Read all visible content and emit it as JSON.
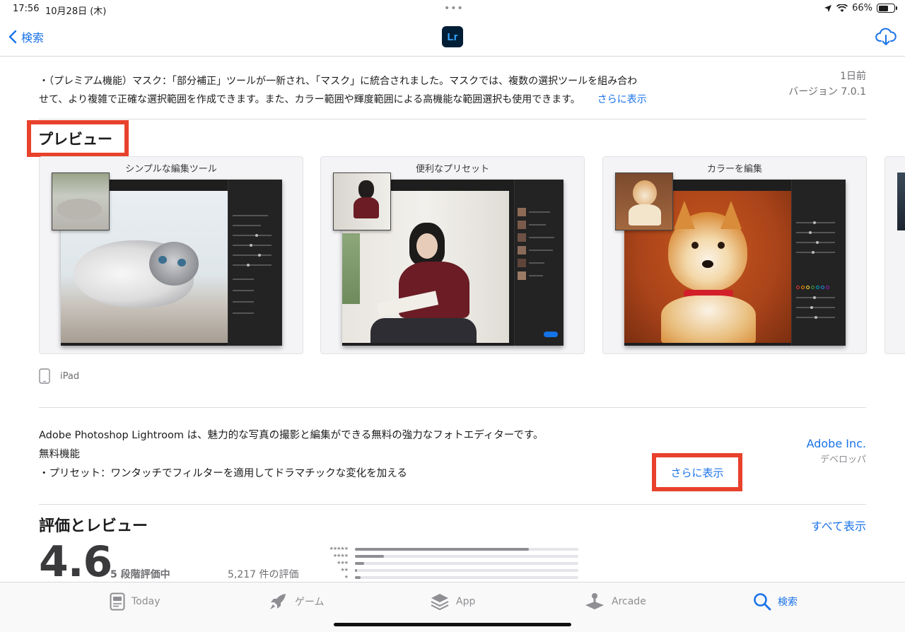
{
  "status": {
    "time": "17:56",
    "date": "10月28日 (木)",
    "battery": "66%",
    "battery_level": 0.66
  },
  "nav": {
    "back_label": "検索",
    "app_icon_label": "Lr"
  },
  "whats_new": {
    "line1": "・（プレミアム機能）マスク：「部分補正」ツールが一新され、「マスク」に統合されました。マスクでは、複数の選択ツールを組み合わ",
    "line2": "せて、より複雑で正確な選択範囲を作成できます。また、カラー範囲や輝度範囲による高機能な範囲選択も使用できます。",
    "more": "さらに表示",
    "date": "1日前",
    "version": "バージョン 7.0.1"
  },
  "preview": {
    "title": "プレビュー",
    "screenshots": [
      {
        "caption": "シンプルな編集ツール"
      },
      {
        "caption": "便利なプリセット"
      },
      {
        "caption": "カラーを編集"
      }
    ],
    "device_label": "iPad"
  },
  "description": {
    "line1": "Adobe Photoshop Lightroom は、魅力的な写真の撮影と編集ができる無料の強力なフォトエディターです。",
    "line2": "無料機能",
    "line3": "・プリセット：ワンタッチでフィルターを適用してドラマチックな変化を加える",
    "more": "さらに表示",
    "developer_name": "Adobe Inc.",
    "developer_role": "デベロッパ"
  },
  "ratings": {
    "title": "評価とレビュー",
    "see_all": "すべて表示",
    "score": "4.6",
    "scale_label": "5 段階評価中",
    "count_label": "5,217 件の評価",
    "distribution": [
      {
        "stars": "★★★★★",
        "fraction": 0.78
      },
      {
        "stars": "★★★★",
        "fraction": 0.13
      },
      {
        "stars": "★★★",
        "fraction": 0.04
      },
      {
        "stars": "★★",
        "fraction": 0.01
      },
      {
        "stars": "★",
        "fraction": 0.025
      }
    ]
  },
  "tabs": [
    {
      "label": "Today",
      "icon": "today-icon",
      "active": false
    },
    {
      "label": "ゲーム",
      "icon": "rocket-icon",
      "active": false
    },
    {
      "label": "App",
      "icon": "apps-stack-icon",
      "active": false
    },
    {
      "label": "Arcade",
      "icon": "joystick-icon",
      "active": false
    },
    {
      "label": "検索",
      "icon": "search-icon",
      "active": true
    }
  ],
  "colors": {
    "accent": "#1a73e8",
    "highlight": "#e8412c"
  }
}
